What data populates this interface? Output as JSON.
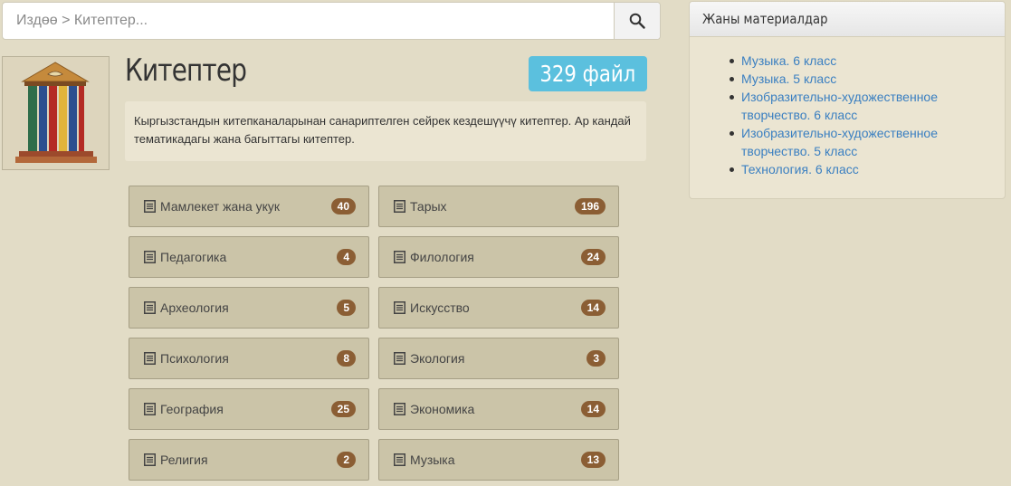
{
  "search": {
    "placeholder": "Издөө > Китептер..."
  },
  "category": {
    "title": "Китептер",
    "file_count": "329 файл",
    "description": "Кыргызстандын китепканаларынан санариптелген сейрек кездешүүчү китептер. Ар кандай тематикадагы жана багыттагы китептер."
  },
  "subcategories": [
    {
      "name": "Мамлекет жана укук",
      "count": "40"
    },
    {
      "name": "Тарых",
      "count": "196"
    },
    {
      "name": "Педагогика",
      "count": "4"
    },
    {
      "name": "Филология",
      "count": "24"
    },
    {
      "name": "Археология",
      "count": "5"
    },
    {
      "name": "Искусство",
      "count": "14"
    },
    {
      "name": "Психология",
      "count": "8"
    },
    {
      "name": "Экология",
      "count": "3"
    },
    {
      "name": "География",
      "count": "25"
    },
    {
      "name": "Экономика",
      "count": "14"
    },
    {
      "name": "Религия",
      "count": "2"
    },
    {
      "name": "Музыка",
      "count": "13"
    }
  ],
  "sidebar": {
    "title": "Жаны материалдар",
    "items": [
      {
        "label": "Музыка. 6 класс"
      },
      {
        "label": "Музыка. 5 класс"
      },
      {
        "label": "Изобразительно-художественное творчество. 6 класс"
      },
      {
        "label": "Изобразительно-художественное творчество. 5 класс"
      },
      {
        "label": "Технология. 6 класс"
      }
    ]
  },
  "colors": {
    "background": "#e2dcc6",
    "file_count_badge": "#5bc0de",
    "count_badge": "#8b5e34",
    "link": "#3a7fc1"
  },
  "icons": {
    "search_button": "search-icon",
    "subcategory": "document-icon",
    "category_image": "books-building-logo"
  }
}
